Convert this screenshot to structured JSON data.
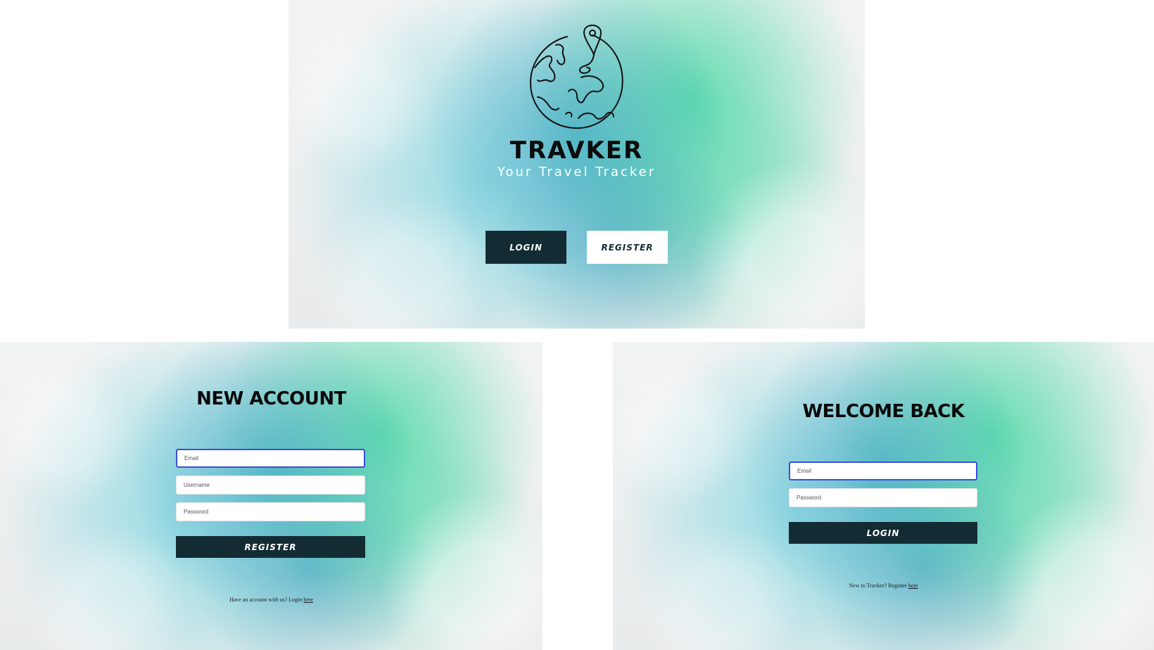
{
  "landing": {
    "brand": "TRAVKER",
    "tagline": "Your Travel Tracker",
    "logo_icon": "globe-with-location-pin-icon",
    "login_label": "LOGIN",
    "register_label": "REGISTER"
  },
  "register_form": {
    "title": "NEW ACCOUNT",
    "email_placeholder": "Email",
    "username_placeholder": "Username",
    "password_placeholder": "Password",
    "submit_label": "REGISTER",
    "footer_text": "Have an account with us? Login ",
    "footer_link": "here"
  },
  "login_form": {
    "title": "WELCOME BACK",
    "email_placeholder": "Email",
    "password_placeholder": "Password",
    "submit_label": "LOGIN",
    "footer_text": "New to Travker? Register ",
    "footer_link": "here"
  },
  "colors": {
    "button_dark": "#132c33",
    "focus_border": "#3b4fd6",
    "wash_teal": "#2496ba",
    "wash_green": "#46d8a0"
  }
}
